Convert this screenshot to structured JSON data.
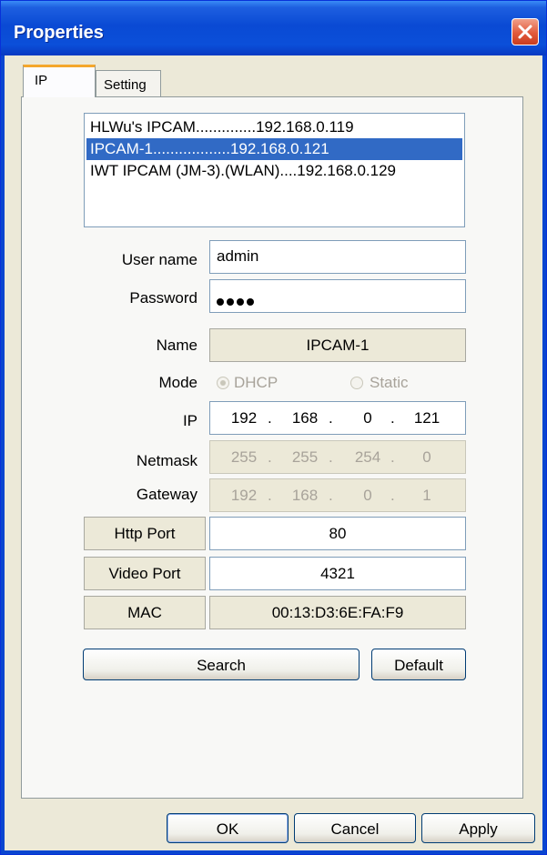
{
  "window": {
    "title": "Properties",
    "close_icon": "close-icon"
  },
  "tabs": [
    {
      "label": "IP",
      "active": true
    },
    {
      "label": "Setting",
      "active": false
    }
  ],
  "device_list": [
    {
      "label": "HLWu's IPCAM..............192.168.0.119",
      "selected": false
    },
    {
      "label": "IPCAM-1..................192.168.0.121",
      "selected": true
    },
    {
      "label": "IWT IPCAM (JM-3).(WLAN)....192.168.0.129",
      "selected": false
    }
  ],
  "form": {
    "user_name": {
      "label": "User name",
      "value": "admin"
    },
    "password": {
      "label": "Password",
      "masked_length": 4
    },
    "name": {
      "label": "Name",
      "value": "IPCAM-1"
    },
    "mode": {
      "label": "Mode",
      "options": [
        "DHCP",
        "Static"
      ],
      "selected": "DHCP"
    },
    "ip": {
      "label": "IP",
      "octets": [
        "192",
        "168",
        "0",
        "121"
      ]
    },
    "netmask": {
      "label": "Netmask",
      "octets": [
        "255",
        "255",
        "254",
        "0"
      ]
    },
    "gateway": {
      "label": "Gateway",
      "octets": [
        "192",
        "168",
        "0",
        "1"
      ]
    },
    "http_port": {
      "label": "Http Port",
      "value": "80"
    },
    "video_port": {
      "label": "Video Port",
      "value": "4321"
    },
    "mac": {
      "label": "MAC",
      "value": "00:13:D3:6E:FA:F9"
    }
  },
  "buttons": {
    "search": "Search",
    "default": "Default",
    "ok": "OK",
    "cancel": "Cancel",
    "apply": "Apply"
  },
  "ip_separator": "."
}
